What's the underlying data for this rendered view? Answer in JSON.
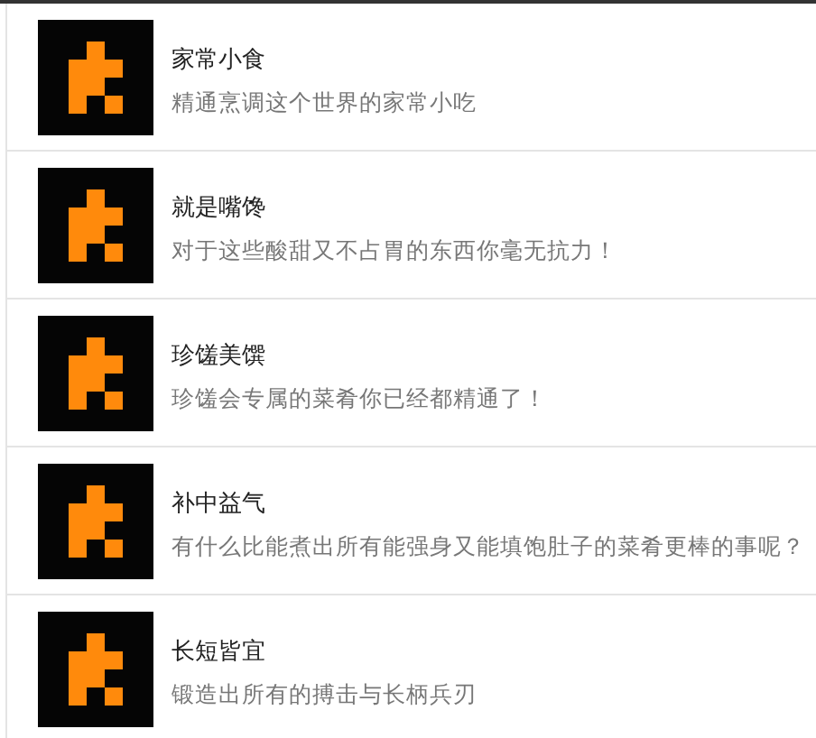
{
  "achievements": [
    {
      "title": "家常小食",
      "description": "精通烹调这个世界的家常小吃"
    },
    {
      "title": "就是嘴馋",
      "description": "对于这些酸甜又不占胃的东西你毫无抗力！"
    },
    {
      "title": "珍馐美馔",
      "description": "珍馐会专属的菜肴你已经都精通了！"
    },
    {
      "title": "补中益气",
      "description": "有什么比能煮出所有能强身又能填饱肚子的菜肴更棒的事呢？"
    },
    {
      "title": "长短皆宜",
      "description": "锻造出所有的搏击与长柄兵刃"
    }
  ]
}
